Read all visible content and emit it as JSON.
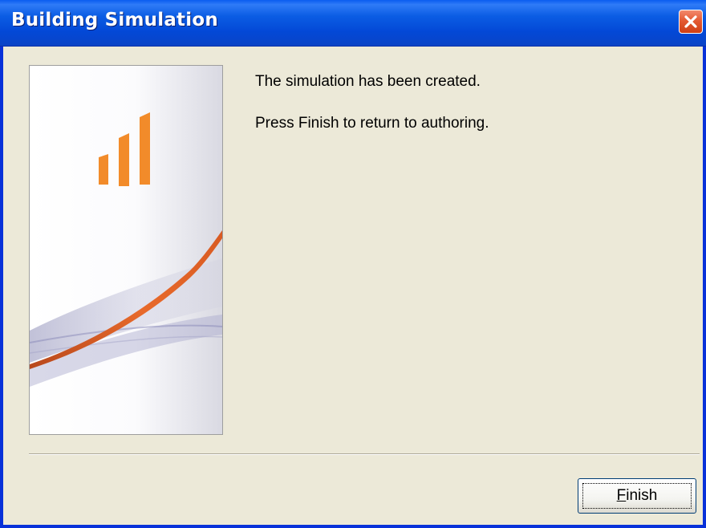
{
  "window": {
    "title": "Building Simulation",
    "accent_color": "#0831D9"
  },
  "titlebar": {
    "close_icon": "close-icon"
  },
  "banner": {
    "logo_icon": "bar-chart-logo",
    "logo_color": "#F28B2A",
    "swoosh_color": "#E86A2B"
  },
  "content": {
    "message_created": "The simulation has been created.",
    "message_finish": "Press Finish to return to authoring."
  },
  "buttons": {
    "finish_label": "Finish",
    "finish_mnemonic": "F",
    "finish_rest": "inish"
  }
}
